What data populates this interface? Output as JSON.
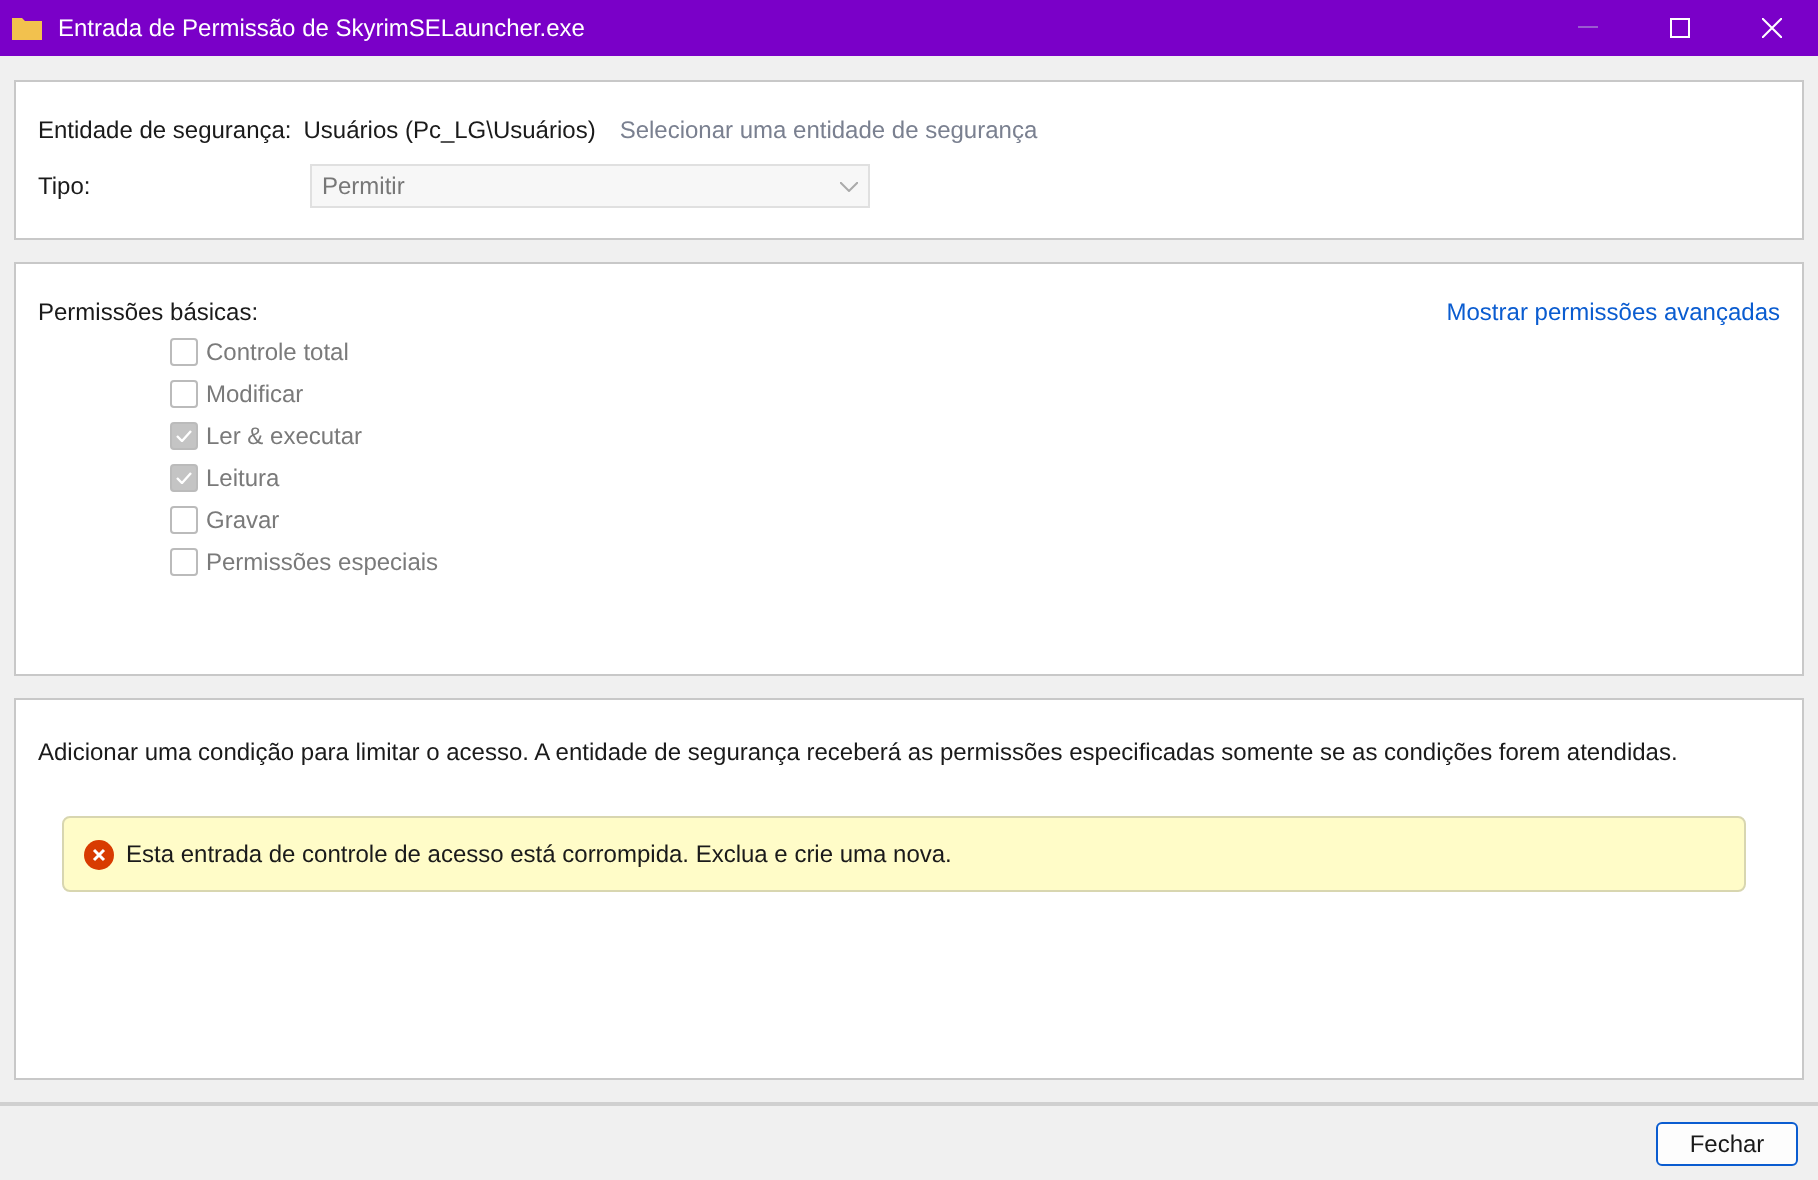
{
  "window": {
    "title": "Entrada de Permissão de SkyrimSELauncher.exe"
  },
  "principal": {
    "label": "Entidade de segurança:",
    "value": "Usuários (Pc_LG\\Usuários)",
    "link": "Selecionar uma entidade de segurança"
  },
  "type": {
    "label": "Tipo:",
    "value": "Permitir",
    "disabled": true
  },
  "permissions": {
    "title": "Permissões básicas:",
    "advanced_link": "Mostrar permissões avançadas",
    "items": [
      {
        "label": "Controle total",
        "checked": false,
        "disabled": true
      },
      {
        "label": "Modificar",
        "checked": false,
        "disabled": true
      },
      {
        "label": "Ler & executar",
        "checked": true,
        "disabled": true
      },
      {
        "label": "Leitura",
        "checked": true,
        "disabled": true
      },
      {
        "label": "Gravar",
        "checked": false,
        "disabled": true
      },
      {
        "label": "Permissões especiais",
        "checked": false,
        "disabled": true
      }
    ]
  },
  "condition": {
    "description": "Adicionar uma condição para limitar o acesso. A entidade de segurança receberá as permissões especificadas somente se as condições forem atendidas.",
    "error": "Esta entrada de controle de acesso está corrompida. Exclua e crie uma nova."
  },
  "buttons": [
    "Fechar"
  ]
}
